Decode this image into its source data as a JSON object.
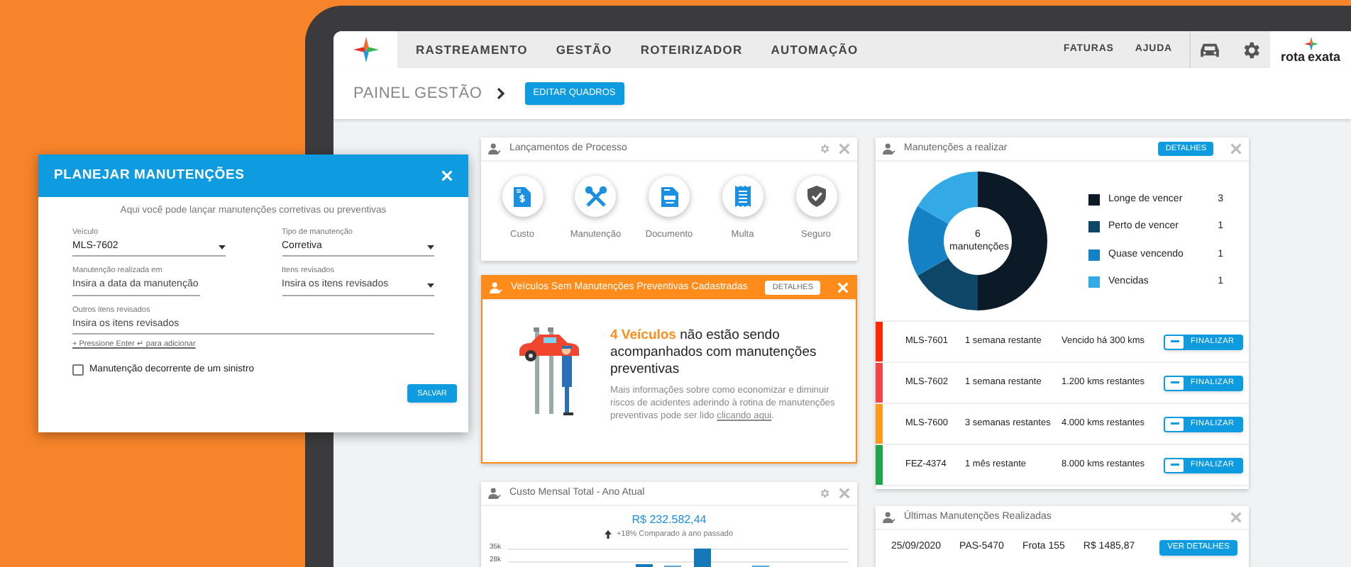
{
  "nav": [
    "RASTREAMENTO",
    "GESTÃO",
    "ROTEIRIZADOR",
    "AUTOMAÇÃO"
  ],
  "utility_links": [
    "FATURAS",
    "AJUDA"
  ],
  "brand": {
    "word_1": "rota",
    "word_2": "exata"
  },
  "breadcrumb": {
    "title": "PAINEL GESTÃO",
    "button": "EDITAR QUADROS"
  },
  "process_card": {
    "title": "Lançamentos de Processo",
    "items": [
      "Custo",
      "Manutenção",
      "Documento",
      "Multa",
      "Seguro"
    ]
  },
  "alert_card": {
    "title": "Veículos Sem Manutenções Preventivas Cadastradas",
    "button": "DETALHES",
    "headline": "**4 Veículos** não estão sendo acompanhados com manutenções preventivas",
    "body": "Mais informações sobre como economizar e diminuir riscos de acidentes aderindo à rotina de manutenções preventivas pode ser lido ",
    "link": "clicando aqui",
    "after_link": "."
  },
  "cost_card": {
    "title": "Custo Mensal Total - Ano Atual",
    "total": "R$ 232.582,44",
    "comparison": "+18% Comparado à ano passado",
    "y_tick_labels": [
      "35k",
      "28k"
    ]
  },
  "due_card": {
    "title": "Manutenções a realizar",
    "button": "DETALHES",
    "center_label": "6 manutenções",
    "chart_data": {
      "type": "donut",
      "categories": [
        "Longe de vencer",
        "Perto de vencer",
        "Quase vencendo",
        "Vencidas"
      ],
      "values": [
        50,
        16.7,
        16.7,
        16.6
      ]
    },
    "legend": [
      {
        "count": "3",
        "color": "#0b1a26"
      },
      {
        "count": "1",
        "color": "#0d4667"
      },
      {
        "count": "1",
        "color": "#1381c4"
      },
      {
        "count": "1",
        "color": "#33a9e6"
      }
    ],
    "rows": [
      {
        "plate": "MLS-7601",
        "time": "1 semana restante",
        "distance": "Vencido há 300 kms",
        "color": "#ff2a00",
        "button": "FINALIZAR"
      },
      {
        "plate": "MLS-7602",
        "time": "1 semana restante",
        "distance": "1.200 kms restantes",
        "color": "#f0464a",
        "button": "FINALIZAR"
      },
      {
        "plate": "MLS-7600",
        "time": "3 semanas restantes",
        "distance": "4.000 kms restantes",
        "color": "#ff9a1a",
        "button": "FINALIZAR"
      },
      {
        "plate": "FEZ-4374",
        "time": "1 mês restante",
        "distance": "8.000 kms restantes",
        "color": "#1fa64a",
        "button": "FINALIZAR"
      }
    ]
  },
  "recent_card": {
    "title": "Últimas Manutenções Realizadas",
    "rows": [
      {
        "columns": [
          "25/09/2020",
          "PAS-5470",
          "Frota 155",
          "R$ 1485,87"
        ],
        "button": "VER DETALHES"
      }
    ]
  },
  "dialog": {
    "title": "PLANEJAR MANUTENÇÕES",
    "subtitle": "Aqui você pode lançar manutenções corretivas ou preventivas",
    "fields": [
      {
        "kind": "select",
        "label": "Veículo",
        "value": "MLS-7602"
      },
      {
        "kind": "select",
        "label": "Tipo de manutenção",
        "value": "Corretiva"
      },
      {
        "kind": "text",
        "label": "Manutenção realizada em",
        "placeholder": "Insira a data da manutenção"
      },
      {
        "kind": "select",
        "label": "Itens revisados",
        "placeholder": "Insira os itens revisados"
      },
      {
        "kind": "wide",
        "label": "Outros itens revisados",
        "placeholder": "Insira os itens revisados"
      }
    ],
    "hint": "+ Pressione Enter ↵ para adicionar",
    "checkbox": {
      "label": "Manutenção decorrente de um sinistro",
      "checked": false
    },
    "button": "SALVAR"
  }
}
